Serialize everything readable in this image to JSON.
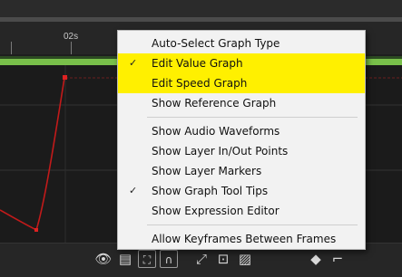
{
  "timeline": {
    "time_label": "02s"
  },
  "context_menu": {
    "items": [
      {
        "label": "Auto-Select Graph Type",
        "checked": false,
        "highlighted": false
      },
      {
        "label": "Edit Value Graph",
        "checked": true,
        "highlighted": true
      },
      {
        "label": "Edit Speed Graph",
        "checked": false,
        "highlighted": true
      },
      {
        "label": "Show Reference Graph",
        "checked": false,
        "highlighted": false
      },
      {
        "label": "Show Audio Waveforms",
        "checked": false,
        "highlighted": false
      },
      {
        "label": "Show Layer In/Out Points",
        "checked": false,
        "highlighted": false
      },
      {
        "label": "Show Layer Markers",
        "checked": false,
        "highlighted": false
      },
      {
        "label": "Show Graph Tool Tips",
        "checked": true,
        "highlighted": false
      },
      {
        "label": "Show Expression Editor",
        "checked": false,
        "highlighted": false
      },
      {
        "label": "Allow Keyframes Between Frames",
        "checked": false,
        "highlighted": false
      }
    ],
    "check_glyph": "✓",
    "highlight_color": "#fff000"
  },
  "toolbar": {
    "icons": [
      {
        "name": "eye-icon",
        "glyph": "👁"
      },
      {
        "name": "graph-type-menu-icon",
        "glyph": "▤"
      },
      {
        "name": "transform-box-icon",
        "glyph": "⛶"
      },
      {
        "name": "snap-magnet-icon",
        "glyph": "∩"
      },
      {
        "name": "fit-selection-icon",
        "glyph": "⤢"
      },
      {
        "name": "fit-all-icon",
        "glyph": "⊡"
      },
      {
        "name": "separate-dimensions-icon",
        "glyph": "▨"
      },
      {
        "name": "convert-keyframe-icon",
        "glyph": "◆"
      },
      {
        "name": "easy-ease-icon",
        "glyph": "⌐"
      }
    ]
  },
  "colors": {
    "curve": "#c21a1a",
    "work_area": "#79c04a"
  }
}
